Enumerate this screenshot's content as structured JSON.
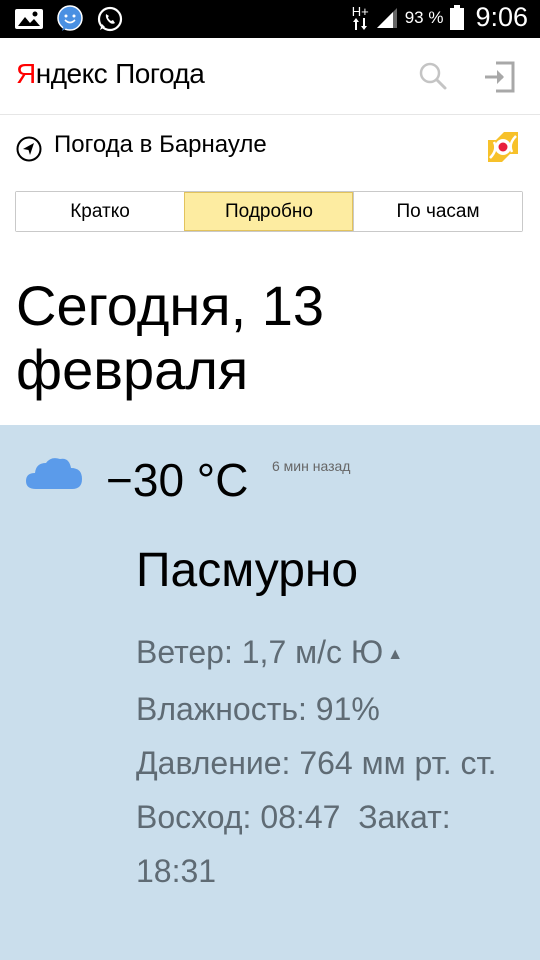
{
  "status_bar": {
    "network_type": "H+",
    "battery_percent": "93 %",
    "time": "9:06",
    "icons": [
      "gallery-icon",
      "chat-icon",
      "whatsapp-icon",
      "data-arrows-icon",
      "signal-icon",
      "battery-icon"
    ]
  },
  "app_bar": {
    "logo_first_letter": "Я",
    "logo_rest": "ндекс",
    "product": "Погода",
    "icons": [
      "search-icon",
      "login-icon"
    ]
  },
  "location": {
    "label": "Погода в Барнауле",
    "icons": [
      "location-arrow-icon",
      "yandex-weather-logo-icon"
    ]
  },
  "tabs": [
    {
      "label": "Кратко",
      "active": false
    },
    {
      "label": "Подробно",
      "active": true
    },
    {
      "label": "По часам",
      "active": false
    }
  ],
  "date_heading": "Сегодня, 13 февраля",
  "current": {
    "temperature": "−30 °C",
    "updated": "6 мин назад",
    "condition": "Пасмурно",
    "wind": "Ветер: 1,7 м/с  Ю",
    "humidity": "Влажность: 91%",
    "pressure": "Давление: 764 мм рт. ст.",
    "sunrise": "Восход: 08:47",
    "sunset": "Закат: 18:31",
    "icon": "cloud-icon"
  },
  "colors": {
    "panel_background": "#cadeec",
    "active_tab": "#fdeca1",
    "logo_red": "#ff0000",
    "detail_text": "#5f6b74"
  }
}
